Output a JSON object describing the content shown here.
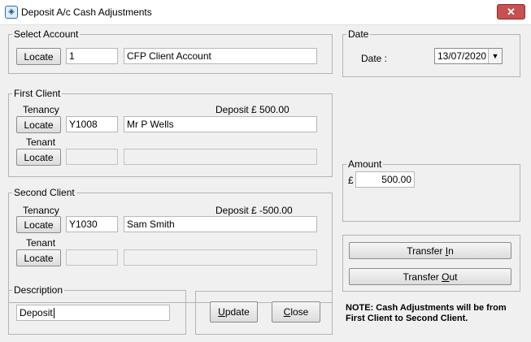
{
  "window": {
    "title": "Deposit A/c Cash Adjustments",
    "close_glyph": "✕"
  },
  "select_account": {
    "legend": "Select Account",
    "locate_label": "Locate",
    "code": "1",
    "name": "CFP Client Account"
  },
  "first_client": {
    "legend": "First Client",
    "tenancy_label": "Tenancy",
    "deposit": "Deposit £ 500.00",
    "tenancy_locate": "Locate",
    "tenancy_code": "Y1008",
    "tenancy_name": "Mr P Wells",
    "tenant_label": "Tenant",
    "tenant_locate": "Locate",
    "tenant_code": "",
    "tenant_name": ""
  },
  "second_client": {
    "legend": "Second Client",
    "tenancy_label": "Tenancy",
    "deposit": "Deposit £ -500.00",
    "tenancy_locate": "Locate",
    "tenancy_code": "Y1030",
    "tenancy_name": "Sam Smith",
    "tenant_label": "Tenant",
    "tenant_locate": "Locate",
    "tenant_code": "",
    "tenant_name": ""
  },
  "description": {
    "legend": "Description",
    "value": "Deposit"
  },
  "date": {
    "legend": "Date",
    "label": "Date :",
    "value": "13/07/2020",
    "dropdown_glyph": "▼"
  },
  "amount": {
    "legend": "Amount",
    "currency": "£",
    "value": "500.00"
  },
  "actions": {
    "update_accel": "U",
    "update_rest": "pdate",
    "close_accel": "C",
    "close_rest": "lose",
    "transfer_in_pre": "Transfer ",
    "transfer_in_accel": "I",
    "transfer_in_rest": "n",
    "transfer_out_pre": "Transfer ",
    "transfer_out_accel": "O",
    "transfer_out_rest": "ut"
  },
  "note": {
    "line1": "NOTE: Cash Adjustments will be from",
    "line2": "First Client to Second Client."
  },
  "colors": {
    "close_button": "#c75050",
    "window_bg": "#f0f0f0"
  }
}
